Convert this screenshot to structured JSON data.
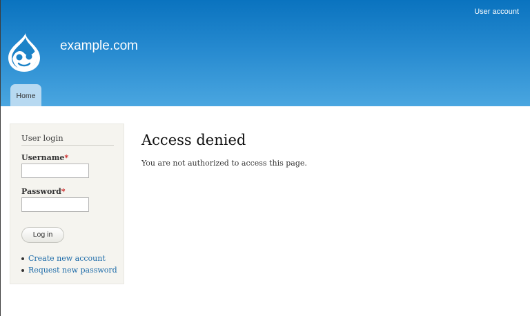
{
  "header": {
    "secondary_menu_label": "User account",
    "site_name": "example.com",
    "main_menu": [
      {
        "label": "Home"
      }
    ]
  },
  "sidebar": {
    "login_block": {
      "title": "User login",
      "username_label": "Username",
      "password_label": "Password",
      "required_marker": "*",
      "username_value": "",
      "password_value": "",
      "submit_label": "Log in",
      "links": [
        {
          "label": "Create new account"
        },
        {
          "label": "Request new password"
        }
      ]
    }
  },
  "main": {
    "title": "Access denied",
    "message": "You are not authorized to access this page."
  },
  "colors": {
    "header_top": "#0a73bf",
    "header_bottom": "#4aa6e0",
    "tab_background": "#b7d9f1",
    "link": "#1b6aa8",
    "required": "#cc2222",
    "sidebar_background": "#f5f4ef"
  },
  "icons": {
    "logo": "drupal-drop-logo-icon"
  }
}
